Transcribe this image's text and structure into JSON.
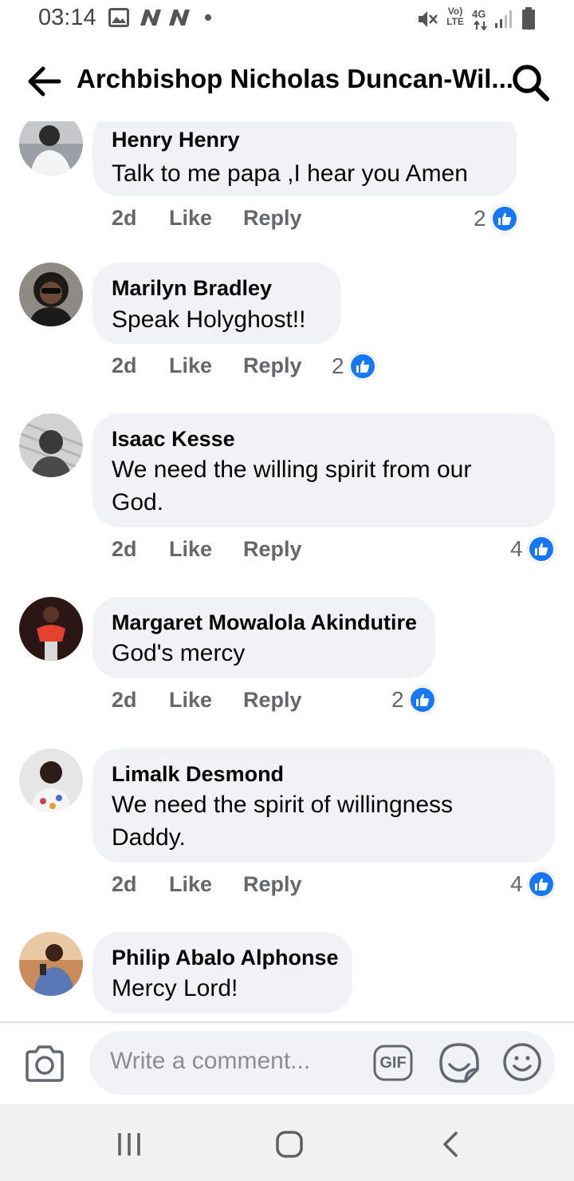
{
  "status_bar": {
    "time": "03:14",
    "network_label": "Vo) LTE",
    "data_label": "4G",
    "icons": [
      "image-icon",
      "notification-n-icon",
      "notification-n-icon",
      "dot-icon",
      "mute-icon",
      "signal-icon",
      "battery-icon"
    ]
  },
  "header": {
    "title": "Archbishop Nicholas Duncan-Wil...",
    "back_icon": "arrow-left-icon",
    "search_icon": "search-icon"
  },
  "comments": [
    {
      "author": "Henry Henry",
      "lines": [
        "Talk to me papa ,I hear you Amen"
      ],
      "time": "2d",
      "like_label": "Like",
      "reply_label": "Reply",
      "reactions": "2"
    },
    {
      "author": "Marilyn Bradley",
      "lines": [
        "Speak Holyghost!!"
      ],
      "time": "2d",
      "like_label": "Like",
      "reply_label": "Reply",
      "reactions": "2"
    },
    {
      "author": "Isaac Kesse",
      "lines": [
        "We need the willing spirit from our",
        "God."
      ],
      "time": "2d",
      "like_label": "Like",
      "reply_label": "Reply",
      "reactions": "4"
    },
    {
      "author": "Margaret Mowalola Akindutire",
      "lines": [
        "God's mercy"
      ],
      "time": "2d",
      "like_label": "Like",
      "reply_label": "Reply",
      "reactions": "2"
    },
    {
      "author": "Limalk Desmond",
      "lines": [
        "We need the spirit of willingness",
        "Daddy."
      ],
      "time": "2d",
      "like_label": "Like",
      "reply_label": "Reply",
      "reactions": "4"
    },
    {
      "author": "Philip Abalo Alphonse",
      "lines": [
        "Mercy Lord!"
      ]
    }
  ],
  "composer": {
    "placeholder": "Write a comment...",
    "camera_icon": "camera-icon",
    "gif_label": "GIF",
    "sticker_icon": "sticker-icon",
    "emoji_icon": "emoji-icon"
  },
  "nav_bar": {
    "icons": [
      "recent-apps-icon",
      "home-icon",
      "back-icon"
    ]
  },
  "colors": {
    "bubble": "#f0f2f5",
    "like_blue": "#1877f2",
    "secondary_text": "#65676b",
    "nav_bg": "#f1f1f1"
  }
}
